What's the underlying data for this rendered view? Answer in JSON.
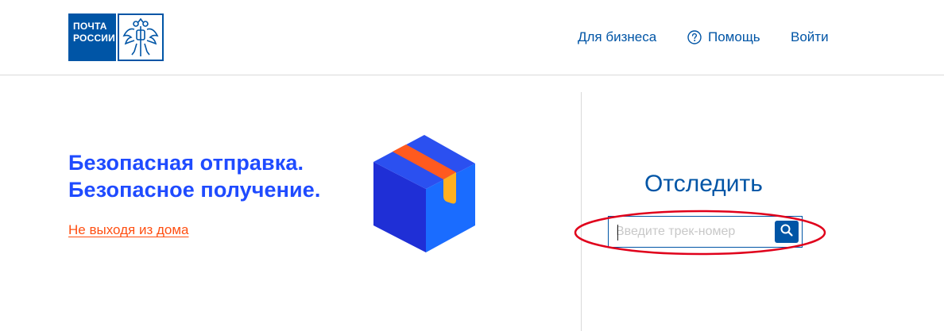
{
  "header": {
    "logo": {
      "line1": "ПОЧТА",
      "line2": "РОССИИ",
      "emblem_icon": "double-headed-eagle-icon"
    },
    "nav": {
      "business": "Для бизнеса",
      "help": "Помощь",
      "help_icon": "question-circle-icon",
      "login": "Войти"
    }
  },
  "hero": {
    "title_line1": "Безопасная отправка.",
    "title_line2": "Безопасное получение.",
    "link": "Не выходя из дома",
    "illustration_icon": "parcel-box-icon"
  },
  "tracking": {
    "title": "Отследить",
    "placeholder": "Введите трек-номер",
    "value": "",
    "search_icon": "search-icon"
  },
  "colors": {
    "brand_blue": "#0055a6",
    "hero_blue": "#1f4bff",
    "link_orange": "#ff4f12",
    "annotation_red": "#e0001b"
  }
}
